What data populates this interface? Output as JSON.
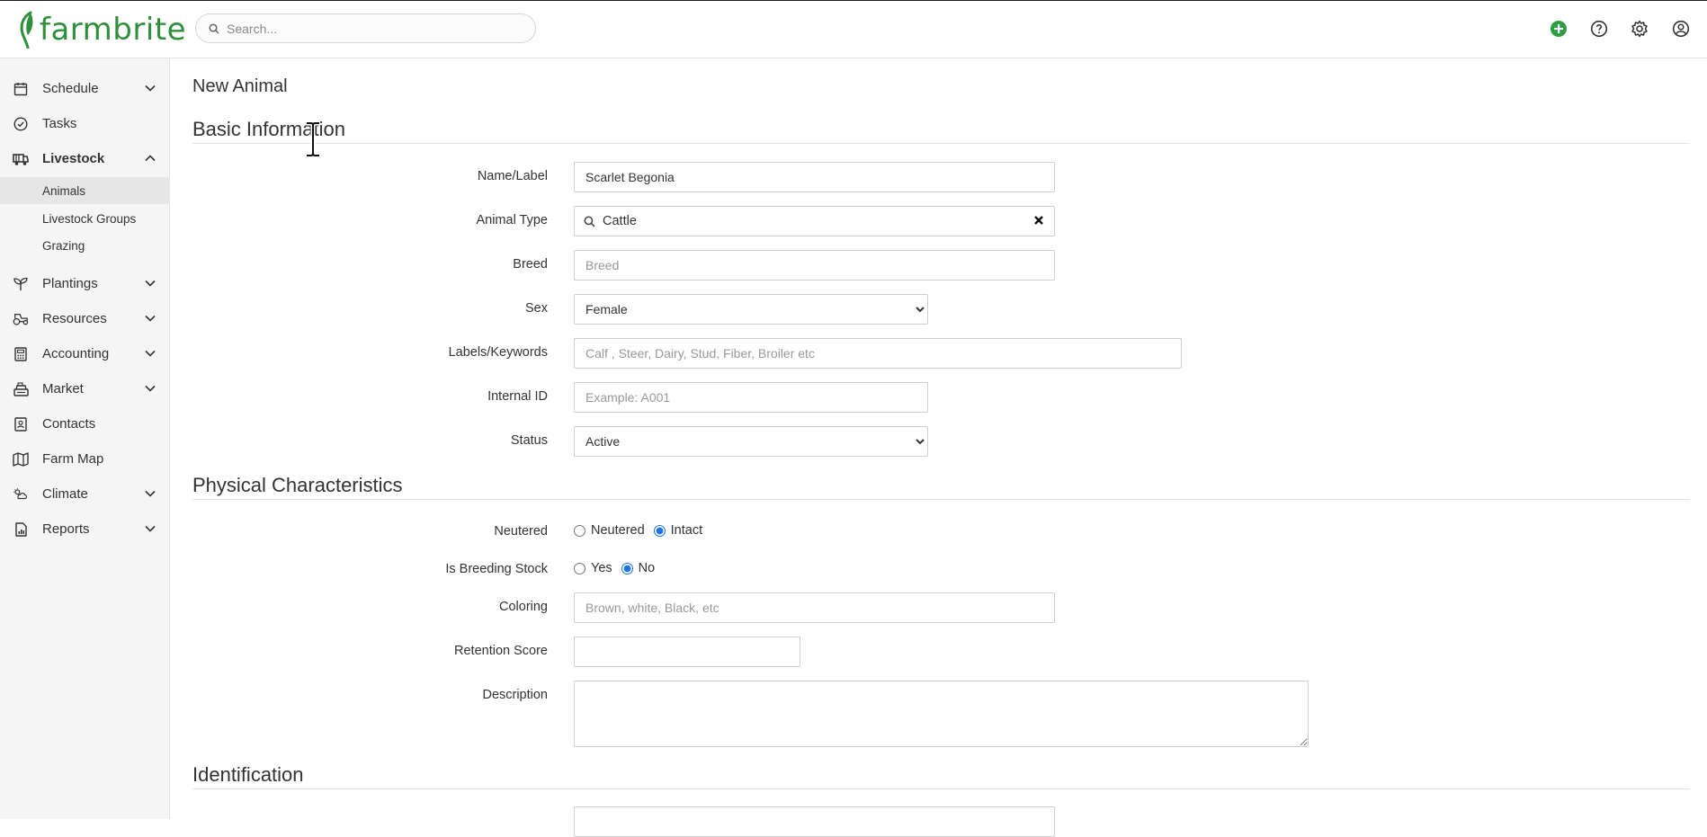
{
  "app": {
    "logo_text": "farmbrite",
    "brand_color": "#2f8f3a",
    "accent_color": "#1a73e8"
  },
  "header": {
    "search_placeholder": "Search...",
    "icons": [
      "plus-circle-icon",
      "help-icon",
      "gear-icon",
      "user-icon"
    ]
  },
  "sidebar": {
    "items": [
      {
        "label": "Schedule",
        "icon": "calendar-icon",
        "expandable": true
      },
      {
        "label": "Tasks",
        "icon": "check-circle-icon",
        "expandable": false
      },
      {
        "label": "Livestock",
        "icon": "tractor-livestock-icon",
        "expandable": true,
        "expanded": true
      },
      {
        "label": "Plantings",
        "icon": "sprout-icon",
        "expandable": true
      },
      {
        "label": "Resources",
        "icon": "tractor-icon",
        "expandable": true
      },
      {
        "label": "Accounting",
        "icon": "calculator-icon",
        "expandable": true
      },
      {
        "label": "Market",
        "icon": "cash-register-icon",
        "expandable": true
      },
      {
        "label": "Contacts",
        "icon": "contact-book-icon",
        "expandable": false
      },
      {
        "label": "Farm Map",
        "icon": "map-icon",
        "expandable": false
      },
      {
        "label": "Climate",
        "icon": "weather-icon",
        "expandable": true
      },
      {
        "label": "Reports",
        "icon": "report-icon",
        "expandable": true
      }
    ],
    "livestock_sub": [
      {
        "label": "Animals",
        "selected": true
      },
      {
        "label": "Livestock Groups",
        "selected": false
      },
      {
        "label": "Grazing",
        "selected": false
      }
    ]
  },
  "main": {
    "page_title": "New Animal",
    "sections": {
      "basic": "Basic Information",
      "physical": "Physical Characteristics",
      "identification": "Identification"
    },
    "fields": {
      "name": {
        "label": "Name/Label",
        "value": "Scarlet Begonia"
      },
      "animal_type": {
        "label": "Animal Type",
        "value": "Cattle"
      },
      "breed": {
        "label": "Breed",
        "placeholder": "Breed"
      },
      "sex": {
        "label": "Sex",
        "value": "Female"
      },
      "labels": {
        "label": "Labels/Keywords",
        "placeholder": "Calf , Steer, Dairy, Stud, Fiber, Broiler etc"
      },
      "internal_id": {
        "label": "Internal ID",
        "placeholder": "Example: A001"
      },
      "status": {
        "label": "Status",
        "value": "Active"
      },
      "neutered": {
        "label": "Neutered",
        "options": [
          "Neutered",
          "Intact"
        ],
        "selected": "Intact"
      },
      "breeding": {
        "label": "Is Breeding Stock",
        "options": [
          "Yes",
          "No"
        ],
        "selected": "No"
      },
      "coloring": {
        "label": "Coloring",
        "placeholder": "Brown, white, Black, etc"
      },
      "retention": {
        "label": "Retention Score",
        "value": ""
      },
      "description": {
        "label": "Description",
        "value": ""
      }
    }
  }
}
